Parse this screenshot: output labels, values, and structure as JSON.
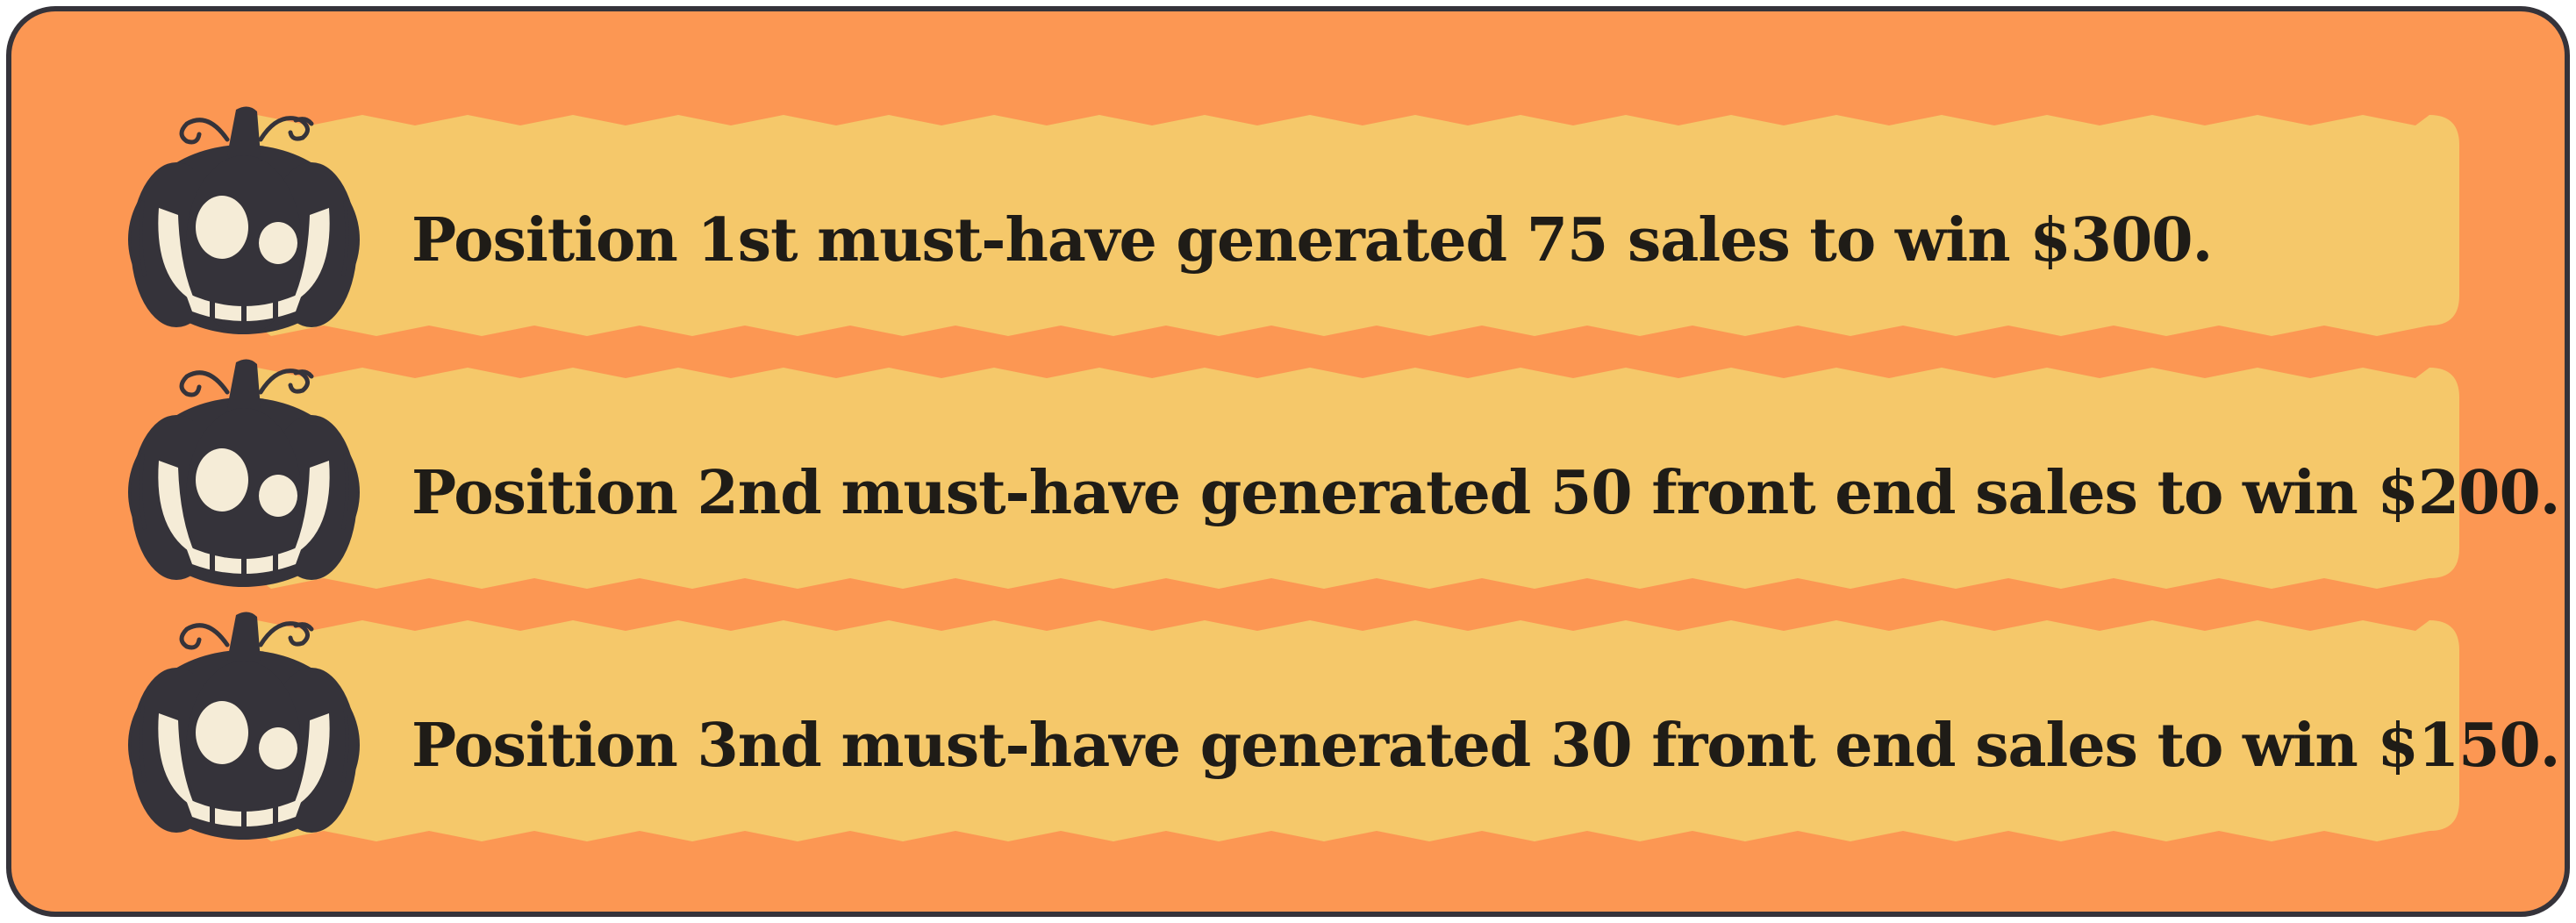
{
  "colors": {
    "frame_border": "#35333a",
    "background": "#fc9753",
    "ribbon": "#f5c86a",
    "pumpkin": "#35333a",
    "pumpkin_face": "#f5ecd7",
    "text": "#1f1c17"
  },
  "icons": {
    "row_icon": "jack-o-lantern-icon"
  },
  "rows": [
    {
      "text": "Position 1st must-have generated 75 sales to win $300."
    },
    {
      "text": "Position 2nd must-have generated 50 front end sales to win $200."
    },
    {
      "text": "Position 3nd must-have generated 30 front end sales to win $150."
    }
  ]
}
